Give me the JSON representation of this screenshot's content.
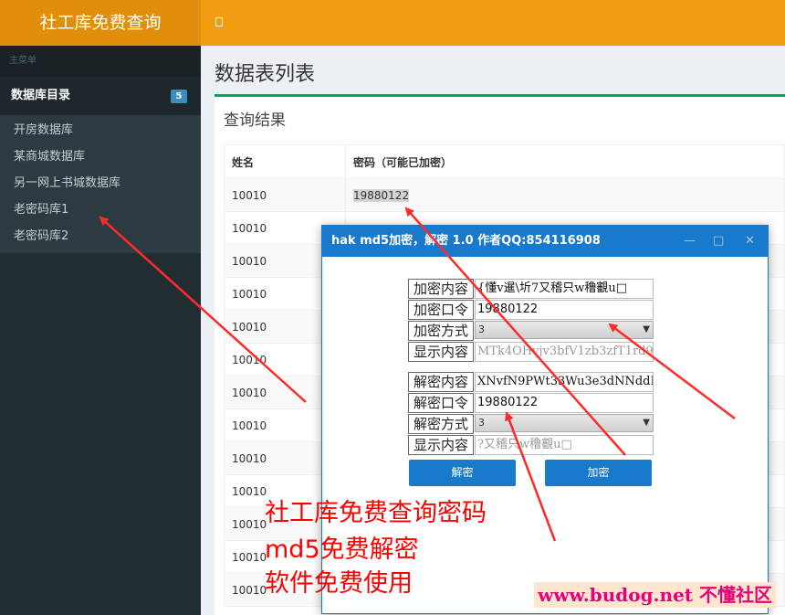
{
  "brand": "社工库免费查询",
  "sidebar": {
    "header": "主菜单",
    "group_label": "数据库目录",
    "group_badge": "5",
    "items": [
      "开房数据库",
      "某商城数据库",
      "另一网上书城数据库",
      "老密码库1",
      "老密码库2"
    ]
  },
  "page": {
    "title": "数据表列表",
    "box_title": "查询结果"
  },
  "table": {
    "headers": [
      "姓名",
      "密码（可能已加密）"
    ],
    "rows": [
      {
        "name": "10010",
        "password": "19880122"
      },
      {
        "name": "10010",
        "password": ""
      },
      {
        "name": "10010",
        "password": ""
      },
      {
        "name": "10010",
        "password": ""
      },
      {
        "name": "10010",
        "password": ""
      },
      {
        "name": "10010",
        "password": ""
      },
      {
        "name": "10010",
        "password": ""
      },
      {
        "name": "10010",
        "password": ""
      },
      {
        "name": "10010",
        "password": ""
      },
      {
        "name": "10010",
        "password": ""
      },
      {
        "name": "10010",
        "password": ""
      },
      {
        "name": "10010",
        "password": ""
      },
      {
        "name": "10010",
        "password": ""
      }
    ]
  },
  "dialog": {
    "title": "hak   md5加密，解密 1.0    作者QQ:854116908",
    "controls": {
      "minimize": "—",
      "maximize": "□",
      "close": "✕"
    },
    "encrypt": {
      "content_label": "加密内容",
      "content_value": "{懂v暹\\圻7又稽只w穞覾u□",
      "key_label": "加密口令",
      "key_value": "19880122",
      "method_label": "加密方式",
      "method_value": "3",
      "display_label": "显示内容",
      "display_value": "MTk4OHvjv3bfV1zb3zfT1rd9"
    },
    "decrypt": {
      "content_label": "解密内容",
      "content_value": "XNvfN9PWt33Wu3e3dNNddRo=",
      "key_label": "解密口令",
      "key_value": "19880122",
      "method_label": "解密方式",
      "method_value": "3",
      "display_label": "显示内容",
      "display_value": "?又稽只w穞覾u□"
    },
    "decrypt_button": "解密",
    "encrypt_button": "加密"
  },
  "overlay": {
    "line1": "社工库免费查询密码",
    "line2": "md5免费解密",
    "line3": "软件免费使用"
  },
  "watermark": "www.budog.net 不懂社区",
  "colors": {
    "brand_dark": "#e08e0b",
    "brand": "#f39c12",
    "sidebar": "#222d32",
    "accent_blue": "#1979ca",
    "box_border": "#00a65a",
    "annotation_red": "#ff0000"
  }
}
